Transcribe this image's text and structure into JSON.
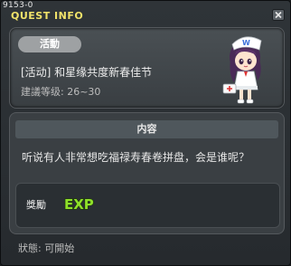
{
  "window": {
    "quest_id": "9153-0",
    "title": "QUEST INFO"
  },
  "quest": {
    "category_badge": "活動",
    "name": "[活动] 和星缘共度新春佳节",
    "level_label": "建議等级: 26~30"
  },
  "content": {
    "header": "内容",
    "description": "听说有人非常想吃福禄寿春卷拼盘，会是谁呢？"
  },
  "reward": {
    "label": "獎勵",
    "exp_text": "EXP"
  },
  "status": {
    "text": "狀態:   可開始"
  },
  "colors": {
    "title": "#f0e26a",
    "exp": "#8fe02a"
  }
}
